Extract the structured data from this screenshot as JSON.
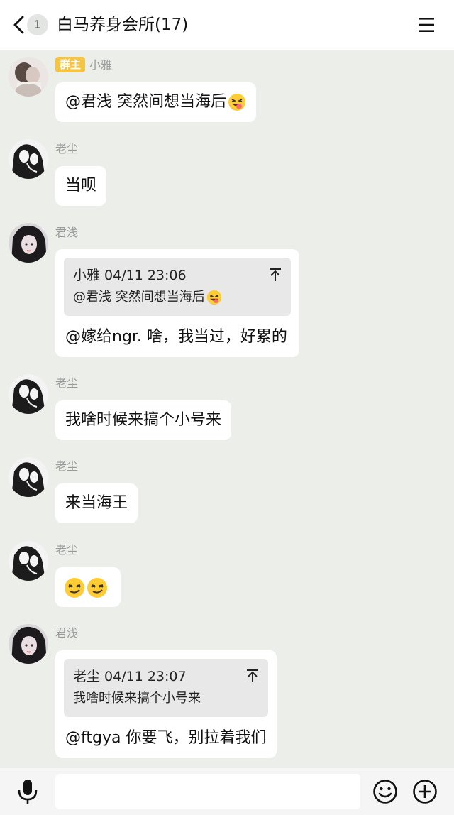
{
  "header": {
    "unread_count": "1",
    "title": "白马养身会所(17)"
  },
  "messages": [
    {
      "sender": "小雅",
      "role": "群主",
      "text": "@君浅 突然间想当海后",
      "emoji": "grinning-squint-tongue"
    },
    {
      "sender": "老尘",
      "text": "当呗"
    },
    {
      "sender": "君浅",
      "quote": {
        "meta": "小雅 04/11 23:06",
        "text": "@君浅 突然间想当海后"
      },
      "text": "@嫁给ngr. 啥，我当过，好累的"
    },
    {
      "sender": "老尘",
      "text": "我啥时候来搞个小号来"
    },
    {
      "sender": "老尘",
      "text": "来当海王"
    },
    {
      "sender": "老尘",
      "emojis": [
        "smirk",
        "smirk"
      ]
    },
    {
      "sender": "君浅",
      "quote": {
        "meta": "老尘 04/11 23:07",
        "text": "我啥时候来搞个小号来"
      },
      "text": "@ftgya 你要飞，别拉着我们"
    }
  ],
  "colors": {
    "background": "#eceeea",
    "bubble": "#ffffff",
    "role_tag": "#f5c542",
    "quote_card": "#e8e8e8"
  },
  "bottombar": {
    "icons": [
      "microphone-icon",
      "emoji-icon",
      "plus-icon"
    ]
  }
}
